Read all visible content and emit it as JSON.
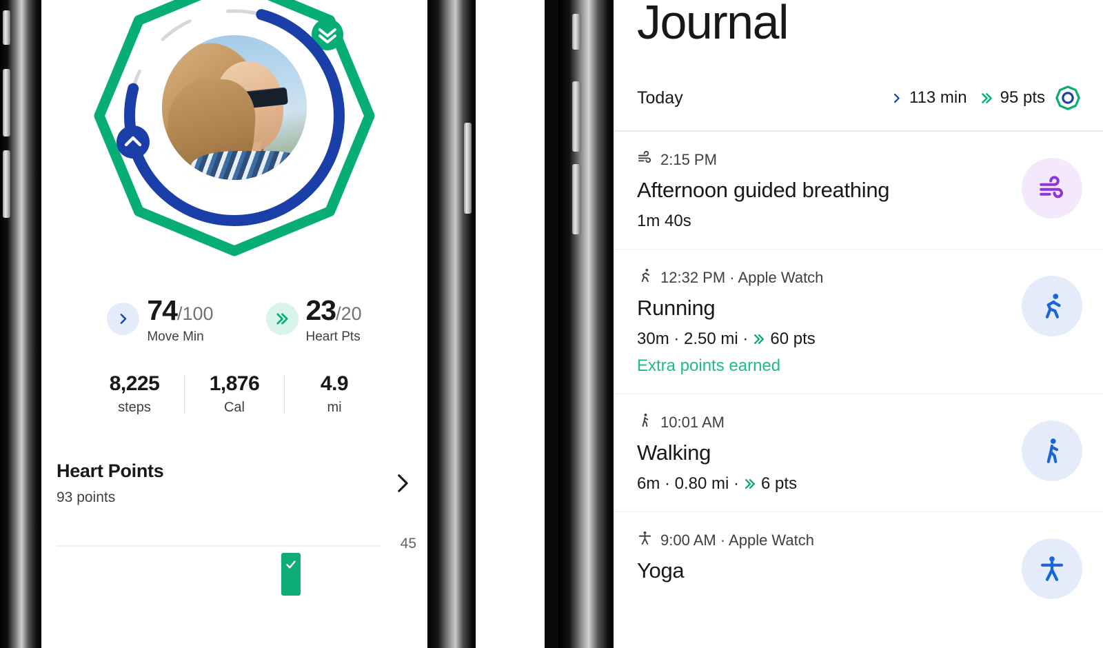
{
  "colors": {
    "move_blue": "#1b3fa8",
    "heart_green": "#07ad77",
    "accent_teal": "#1fb98c",
    "text_primary": "#17181a",
    "text_secondary": "#3c4043",
    "purple": "#8f35d8",
    "bar_green": "#0dad75"
  },
  "left_phone": {
    "info_icon": "info-circle-icon",
    "rings": {
      "move_min_icon": "chevron-up-icon",
      "heart_points_icon": "double-chevron-down-icon",
      "avatar": "user-profile-photo"
    },
    "metrics": [
      {
        "icon": "single-chevron-right-icon",
        "value": "74",
        "goal": "/100",
        "label": "Move Min"
      },
      {
        "icon": "double-chevron-right-icon",
        "value": "23",
        "goal": "/20",
        "label": "Heart Pts"
      }
    ],
    "totals": [
      {
        "value": "8,225",
        "label": "steps"
      },
      {
        "value": "1,876",
        "label": "Cal"
      },
      {
        "value": "4.9",
        "label": "mi"
      }
    ],
    "heart_points_card": {
      "title": "Heart Points",
      "subtitle": "93 points",
      "chevron_icon": "chevron-right-icon",
      "gridline_label": "45",
      "bar_icon": "check-icon"
    }
  },
  "right_phone": {
    "title": "Journal",
    "today": {
      "label": "Today",
      "move_icon": "single-chevron-right-icon",
      "move_value": "113 min",
      "heart_icon": "double-chevron-right-icon",
      "heart_value": "95 pts",
      "goal_icon": "goal-ring-icon"
    },
    "entries": [
      {
        "meta_icon": "wind-icon",
        "meta": "2:15 PM",
        "title": "Afternoon guided breathing",
        "stats": "1m 40s",
        "extra": "",
        "avatar_icon": "wind-icon",
        "avatar_style": "purple"
      },
      {
        "meta_icon": "running-icon",
        "meta": "12:32 PM · Apple Watch",
        "title": "Running",
        "stats_pre": "30m · 2.50 mi ·",
        "stats_icon": "double-chevron-right-icon",
        "stats_post": "60 pts",
        "extra": "Extra points earned",
        "avatar_icon": "running-icon",
        "avatar_style": "blue"
      },
      {
        "meta_icon": "walking-icon",
        "meta": "10:01 AM",
        "title": "Walking",
        "stats_pre": "6m · 0.80 mi ·",
        "stats_icon": "double-chevron-right-icon",
        "stats_post": "6 pts",
        "extra": "",
        "avatar_icon": "walking-icon",
        "avatar_style": "blue"
      },
      {
        "meta_icon": "yoga-icon",
        "meta": "9:00 AM · Apple Watch",
        "title": "Yoga",
        "stats_pre": "",
        "stats_icon": "",
        "stats_post": "",
        "extra": "",
        "avatar_icon": "yoga-icon",
        "avatar_style": "blue"
      }
    ]
  }
}
